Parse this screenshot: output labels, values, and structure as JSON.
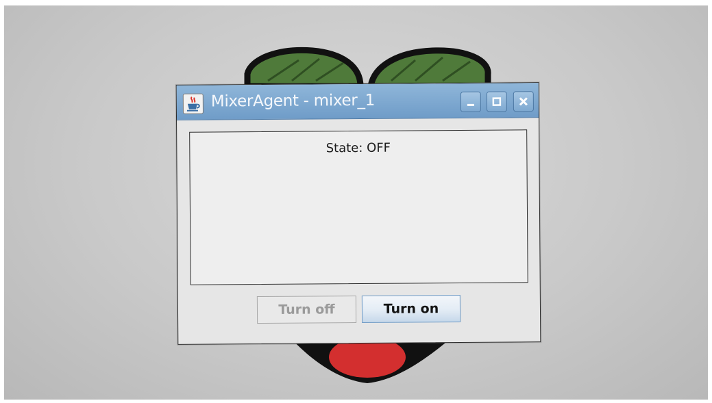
{
  "window": {
    "title": "MixerAgent - mixer_1"
  },
  "panel": {
    "state_text": "State: OFF"
  },
  "buttons": {
    "turn_off": "Turn off",
    "turn_on": "Turn on"
  },
  "icons": {
    "app": "java-coffee-cup-icon",
    "minimize": "minimize-icon",
    "maximize": "maximize-icon",
    "close": "close-icon",
    "wallpaper_logo": "raspberry-pi-logo"
  },
  "colors": {
    "titlebar": "#7ea9d1",
    "window_bg": "#e6e6e6",
    "primary_button_border": "#6f9bc6",
    "disabled_text": "#9a9a9a"
  }
}
